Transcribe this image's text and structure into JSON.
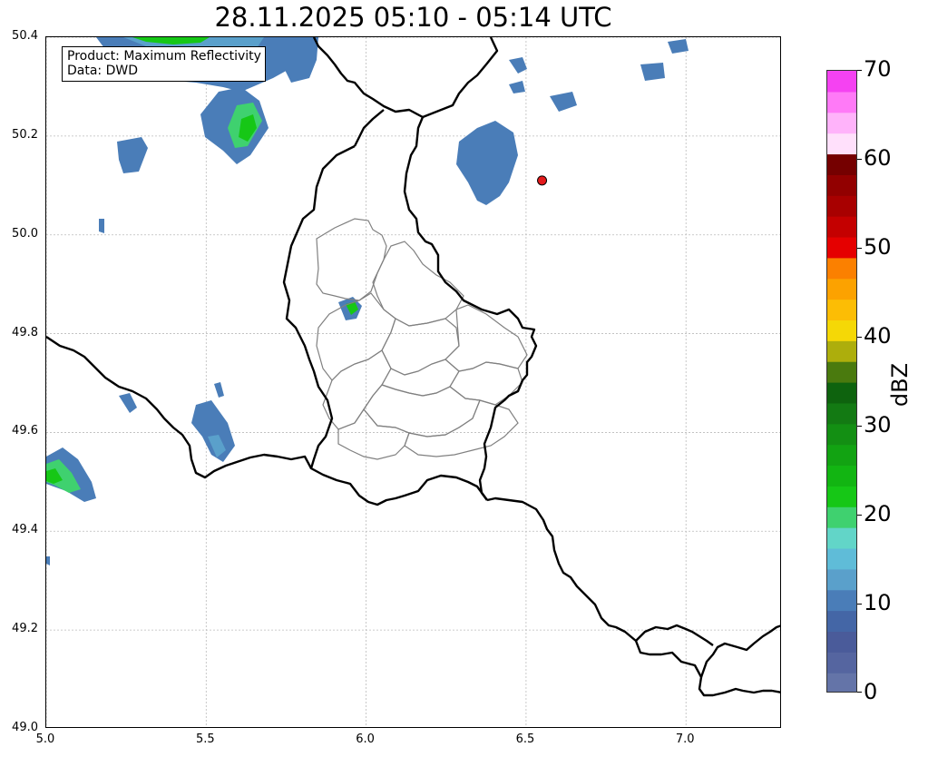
{
  "title": "28.11.2025 05:10 - 05:14 UTC",
  "info_box": {
    "product": "Product: Maximum Reflectivity",
    "data": "Data: DWD"
  },
  "map": {
    "lon_range": [
      5.0,
      7.3
    ],
    "lat_range": [
      49.0,
      50.4
    ],
    "x_ticks": [
      "5.0",
      "5.5",
      "6.0",
      "6.5",
      "7.0"
    ],
    "y_ticks": [
      "49.0",
      "49.2",
      "49.4",
      "49.6",
      "49.8",
      "50.0",
      "50.2",
      "50.4"
    ],
    "grid": true,
    "marker": {
      "lon": 6.55,
      "lat": 50.11,
      "color": "#e31a1c"
    },
    "colors": {
      "national_border": "#000000",
      "district_border": "#808080",
      "gridline": "#bbbbbb"
    }
  },
  "colorbar": {
    "label": "dBZ",
    "range": [
      0,
      70
    ],
    "ticks": [
      "0",
      "10",
      "20",
      "30",
      "40",
      "50",
      "60",
      "70"
    ],
    "colors": [
      "#6474a8",
      "#5565a0",
      "#4a5b9a",
      "#4466a6",
      "#4a7db8",
      "#5aa0cb",
      "#5fbcd8",
      "#62d5c8",
      "#3fd16f",
      "#16c716",
      "#12b512",
      "#12a312",
      "#138f13",
      "#137a13",
      "#0e630e",
      "#4a7a0e",
      "#adae0c",
      "#f5d806",
      "#fcbd05",
      "#fca200",
      "#fb8000",
      "#e50000",
      "#c40000",
      "#a80000",
      "#920000",
      "#750000",
      "#ffe0fb",
      "#ffb3fa",
      "#ff7af7",
      "#f542f2"
    ]
  },
  "chart_data": {
    "type": "heatmap",
    "title": "28.11.2025 05:10 - 05:14 UTC",
    "xlim": [
      5.0,
      7.3
    ],
    "ylim": [
      49.0,
      50.4
    ],
    "colorbar_label": "dBZ",
    "colorbar_range": [
      0,
      70
    ],
    "annotation": [
      "Product: Maximum Reflectivity",
      "Data: DWD"
    ]
  }
}
